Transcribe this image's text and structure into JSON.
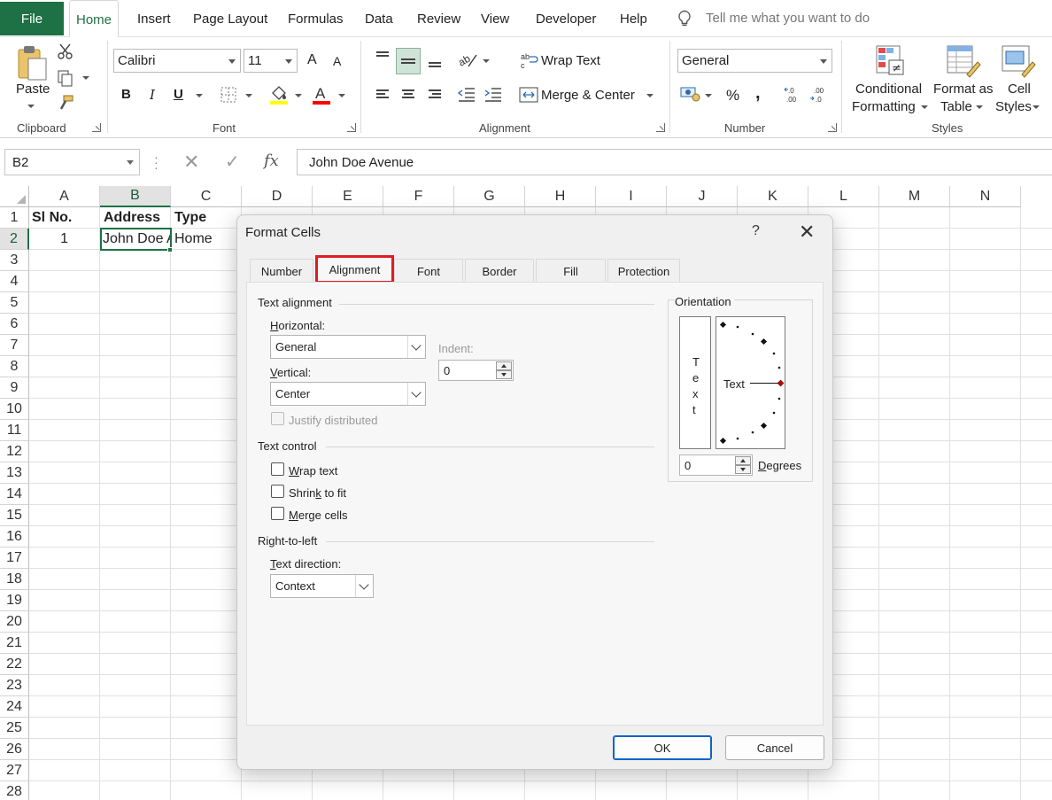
{
  "menu": {
    "file": "File",
    "tabs": [
      "Home",
      "Insert",
      "Page Layout",
      "Formulas",
      "Data",
      "Review",
      "View",
      "Developer",
      "Help"
    ],
    "active_tab": "Home",
    "tell_me": "Tell me what you want to do"
  },
  "ribbon": {
    "clipboard": {
      "paste": "Paste",
      "label": "Clipboard"
    },
    "font": {
      "name": "Calibri",
      "size": "11",
      "bold": "B",
      "italic": "I",
      "underline": "U",
      "grow": "A",
      "shrink": "A",
      "label": "Font",
      "fill_color": "#ffff00",
      "font_color": "#ff0000"
    },
    "alignment": {
      "wrap_text": "Wrap Text",
      "merge_center": "Merge & Center",
      "label": "Alignment"
    },
    "number": {
      "format": "General",
      "percent": "%",
      "comma": ",",
      "inc_decimal": "←.0\n.00",
      "label": "Number"
    },
    "styles": {
      "conditional_1": "Conditional",
      "conditional_2": "Formatting",
      "format_table_1": "Format as",
      "format_table_2": "Table",
      "cell_styles_1": "Cell",
      "cell_styles_2": "Styles",
      "label": "Styles"
    }
  },
  "formula_bar": {
    "name_box": "B2",
    "cancel": "✕",
    "enter": "✓",
    "fx": "fx",
    "value": "John Doe Avenue"
  },
  "grid": {
    "columns": [
      "A",
      "B",
      "C",
      "D",
      "E",
      "F",
      "G",
      "H",
      "I",
      "J",
      "K",
      "L",
      "M",
      "N"
    ],
    "rows": [
      "1",
      "2",
      "3",
      "4",
      "5",
      "6",
      "7",
      "8",
      "9",
      "10",
      "11",
      "12",
      "13",
      "14",
      "15",
      "16",
      "17",
      "18",
      "19",
      "20",
      "21",
      "22",
      "23",
      "24",
      "25",
      "26",
      "27",
      "28"
    ],
    "selected_col": "B",
    "selected_row": "2",
    "cells": {
      "A1": "Sl No.",
      "B1": "Address",
      "C1": "Type",
      "A2": "1",
      "B2": "John Doe Avenue",
      "C2": "Home"
    }
  },
  "dialog": {
    "title": "Format Cells",
    "help": "?",
    "close": "✕",
    "tabs": [
      "Number",
      "Alignment",
      "Font",
      "Border",
      "Fill",
      "Protection"
    ],
    "active_tab": "Alignment",
    "text_alignment": {
      "title": "Text alignment",
      "horizontal_label": "Horizontal:",
      "horizontal_value": "General",
      "indent_label": "Indent:",
      "indent_value": "0",
      "vertical_label": "Vertical:",
      "vertical_value": "Center",
      "justify_distributed": "Justify distributed"
    },
    "text_control": {
      "title": "Text control",
      "wrap_text": "Wrap text",
      "shrink_to_fit": "Shrink to fit",
      "merge_cells": "Merge cells"
    },
    "rtl": {
      "title": "Right-to-left",
      "direction_label": "Text direction:",
      "direction_value": "Context"
    },
    "orientation": {
      "title": "Orientation",
      "vertical_text": [
        "T",
        "e",
        "x",
        "t"
      ],
      "dial_text": "Text",
      "degrees_value": "0",
      "degrees_label": "Degrees"
    },
    "ok": "OK",
    "cancel": "Cancel",
    "highlight_color": "#e01b24"
  }
}
